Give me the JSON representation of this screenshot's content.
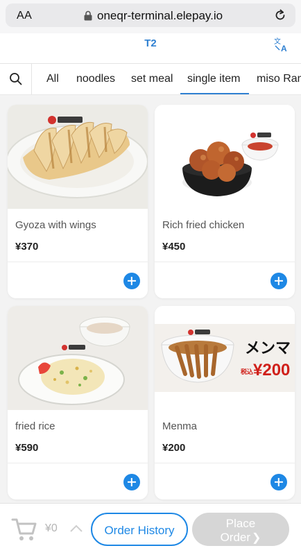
{
  "browser": {
    "text_size": "AA",
    "url": "oneqr-terminal.elepay.io"
  },
  "header": {
    "table_number": "T2"
  },
  "tabs": [
    {
      "label": "All"
    },
    {
      "label": "noodles"
    },
    {
      "label": "set meal"
    },
    {
      "label": "single item",
      "active": true
    },
    {
      "label": "miso Ram"
    }
  ],
  "items": [
    {
      "name": "Gyoza with wings",
      "price": "¥370"
    },
    {
      "name": "Rich fried chicken",
      "price": "¥450"
    },
    {
      "name": "fried rice",
      "price": "¥590"
    },
    {
      "name": "Menma",
      "price": "¥200",
      "promo_title": "メンマ",
      "promo_tag": "税込",
      "promo_price": "¥200"
    }
  ],
  "cart": {
    "total": "¥0"
  },
  "buttons": {
    "history_line1": "Order",
    "history_line2": "History",
    "place_line1": "Place",
    "place_line2": "Order"
  },
  "colors": {
    "accent": "#1e88e5",
    "disabled": "#d6d6d6"
  },
  "icons": [
    "lock-icon",
    "reload-icon",
    "translate-icon",
    "search-icon",
    "add-icon",
    "cart-icon",
    "chevron-up-icon",
    "chevron-right-icon"
  ]
}
